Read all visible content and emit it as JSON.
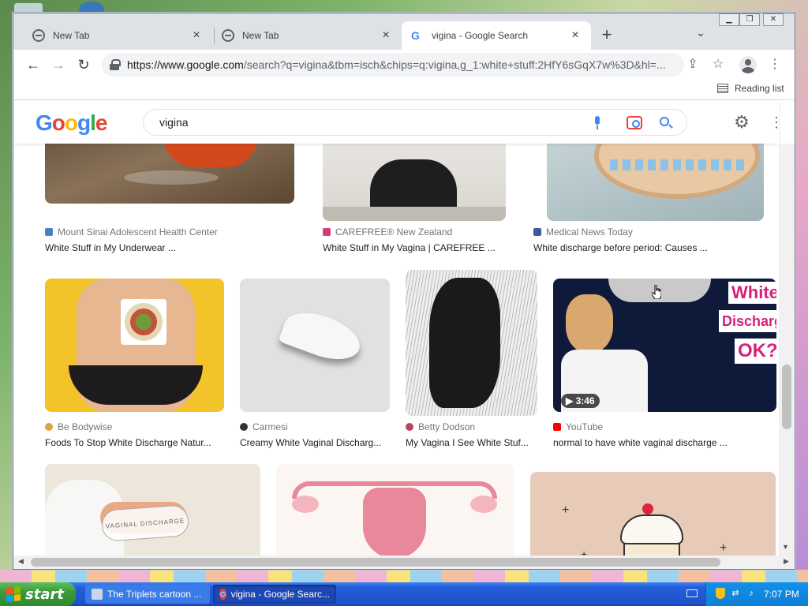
{
  "browser": {
    "tabs": [
      {
        "title": "New Tab",
        "close": "×"
      },
      {
        "title": "New Tab",
        "close": "×"
      },
      {
        "title": "vigina - Google Search",
        "close": "×"
      }
    ],
    "new_tab": "+",
    "tab_list": "⌄",
    "window_controls": [
      "▁",
      "❐",
      "✕"
    ],
    "nav": {
      "back": "←",
      "forward": "→",
      "reload": "↻"
    },
    "url_host": "https://www.google.com",
    "url_rest": "/search?q=vigina&tbm=isch&chips=q:vigina,g_1:white+stuff:2HfY6sGqX7w%3D&hl=...",
    "share_icon": "⇪",
    "star_icon": "☆",
    "menu_icon": "⋮",
    "reading_list": "Reading list"
  },
  "google": {
    "logo": [
      "G",
      "o",
      "o",
      "g",
      "l",
      "e"
    ],
    "query": "vigina",
    "settings_icon": "⚙",
    "apps_icon": "⋮"
  },
  "results": {
    "row1": [
      {
        "source": "Mount Sinai Adolescent Health Center",
        "caption": "White Stuff in My Underwear ..."
      },
      {
        "source": "CAREFREE® New Zealand",
        "caption": "White Stuff in My Vagina | CAREFREE ..."
      },
      {
        "source": "Medical News Today",
        "caption": "White discharge before period: Causes ..."
      }
    ],
    "row2": [
      {
        "source": "Be Bodywise",
        "caption": "Foods To Stop White Discharge Natur..."
      },
      {
        "source": "Carmesi",
        "caption": "Creamy White Vaginal Discharg..."
      },
      {
        "source": "Betty Dodson",
        "caption": "My Vagina I See White Stuf..."
      },
      {
        "source": "YouTube",
        "caption": "normal to have white vaginal discharge ..."
      }
    ],
    "video": {
      "duration": "3:46",
      "overlay_lines": [
        "White",
        "Discharg",
        "OK?"
      ]
    },
    "product_text": "VAGINAL DISCHARGE"
  },
  "taskbar": {
    "start_label": "start",
    "tasks": [
      "The Triplets cartoon ...",
      "vigina - Google Searc..."
    ],
    "clock": "7:07 PM"
  },
  "colors": {
    "google_blue": "#4285f4",
    "google_red": "#ea4335",
    "google_yellow": "#fbbc05",
    "google_green": "#34a853",
    "youtube_red": "#ff0000"
  }
}
